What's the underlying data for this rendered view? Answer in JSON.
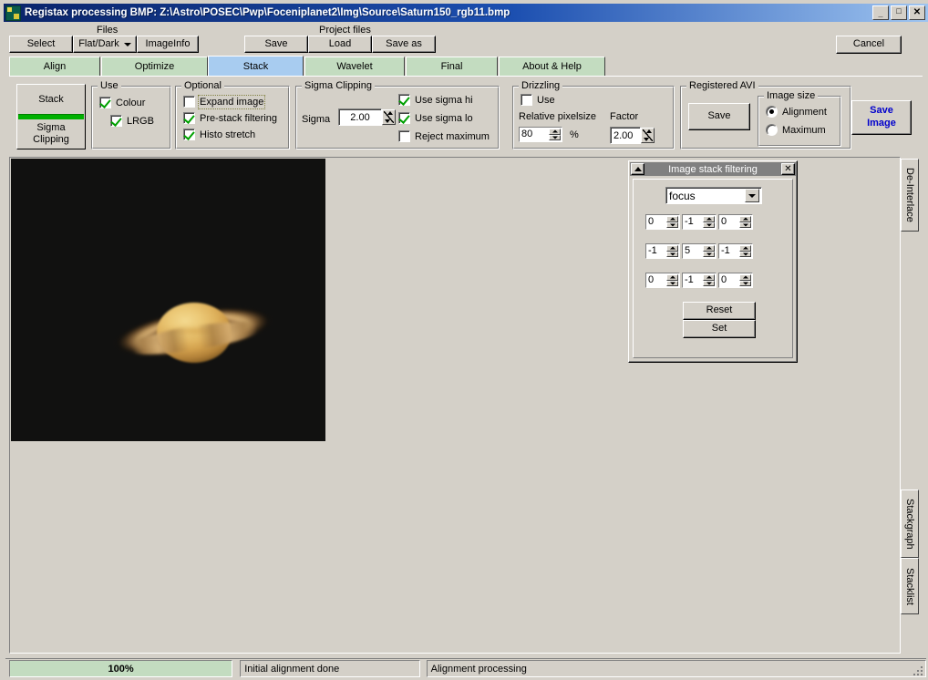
{
  "window": {
    "title": "Registax processing BMP: Z:\\Astro\\POSEC\\Pwp\\Foceniplanet2\\Img\\Source\\Saturn150_rgb11.bmp",
    "icon": "registax-app-icon",
    "minimize": "_",
    "maximize": "□",
    "close": "✕"
  },
  "toolbar": {
    "files_caption": "Files",
    "project_caption": "Project files",
    "select": "Select",
    "flatdark": "Flat/Dark",
    "imageinfo": "ImageInfo",
    "save": "Save",
    "load": "Load",
    "save_as": "Save as",
    "cancel": "Cancel"
  },
  "tabs": [
    {
      "label": "Align",
      "active": false
    },
    {
      "label": "Optimize",
      "active": false
    },
    {
      "label": "Stack",
      "active": true
    },
    {
      "label": "Wavelet",
      "active": false
    },
    {
      "label": "Final",
      "active": false
    },
    {
      "label": "About & Help",
      "active": false
    }
  ],
  "stack_panel": {
    "stack_button": "Stack",
    "sigma_clipping_button": "Sigma\nClipping",
    "sigma_button_line1": "Sigma",
    "sigma_button_line2": "Clipping",
    "accent_green": "#00b000"
  },
  "use_group": {
    "caption": "Use",
    "items": [
      {
        "label": "Colour",
        "checked": true
      },
      {
        "label": "LRGB",
        "checked": true
      }
    ]
  },
  "optional_group": {
    "caption": "Optional",
    "items": [
      {
        "label": "Expand image",
        "checked": false,
        "focused": true
      },
      {
        "label": "Pre-stack filtering",
        "checked": true,
        "focused": false
      },
      {
        "label": "Histo stretch",
        "checked": true,
        "focused": false
      }
    ]
  },
  "sigma_clipping_group": {
    "caption": "Sigma Clipping",
    "sigma_label": "Sigma",
    "sigma_value": "2.00",
    "items": [
      {
        "label": "Use sigma hi",
        "checked": true
      },
      {
        "label": "Use sigma lo",
        "checked": true
      },
      {
        "label": "Reject maximum",
        "checked": false
      }
    ]
  },
  "drizzling_group": {
    "caption": "Drizzling",
    "use_label": "Use",
    "use_checked": false,
    "relative_pixelsize_label": "Relative pixelsize",
    "relative_pixelsize_value": "80",
    "percent_symbol": "%",
    "factor_label": "Factor",
    "factor_value": "2.00"
  },
  "registered_avi_group": {
    "caption": "Registered AVI",
    "save_button": "Save",
    "image_size_caption": "Image size",
    "options": [
      {
        "label": "Alignment",
        "selected": true
      },
      {
        "label": "Maximum",
        "selected": false
      }
    ]
  },
  "save_image_button": {
    "line1": "Save",
    "line2": "Image",
    "color": "#0000cc"
  },
  "dialog": {
    "title": "Image stack filtering",
    "rollup_icon": "▲",
    "close_icon": "✕",
    "filter_selected": "focus",
    "matrix": [
      [
        "0",
        "-1",
        "0"
      ],
      [
        "-1",
        "5",
        "-1"
      ],
      [
        "0",
        "-1",
        "0"
      ]
    ],
    "reset_button": "Reset",
    "set_button": "Set"
  },
  "side_tabs": [
    {
      "label": "De-Interlace"
    },
    {
      "label": "Stackgraph"
    },
    {
      "label": "Stacklist"
    }
  ],
  "statusbar": {
    "progress_text": "100%",
    "progress_percent": 100,
    "progress_color": "#c3dcc0",
    "message_left": "Initial alignment done",
    "message_right": "Alignment processing"
  },
  "image_view": {
    "subject": "saturn-planet-image",
    "background": "#111110"
  }
}
